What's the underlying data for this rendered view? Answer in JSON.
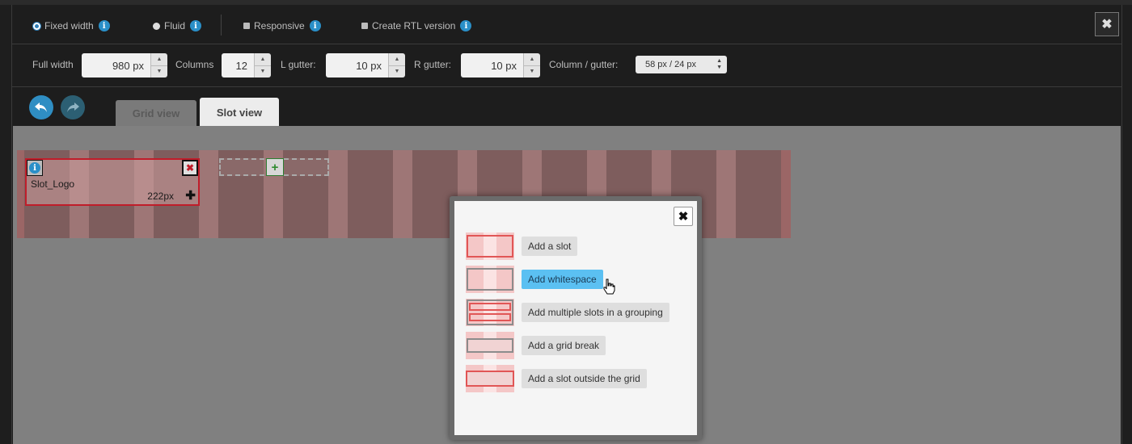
{
  "layout_modes": {
    "fixed_width": "Fixed width",
    "fluid": "Fluid",
    "responsive": "Responsive",
    "rtl": "Create RTL version",
    "info_glyph": "i"
  },
  "window": {
    "close_glyph": "✖"
  },
  "settings": {
    "full_width_label": "Full width",
    "full_width_value": "980 px",
    "columns_label": "Columns",
    "columns_value": "12",
    "l_gutter_label": "L gutter:",
    "l_gutter_value": "10 px",
    "r_gutter_label": "R gutter:",
    "r_gutter_value": "10 px",
    "col_gutter_label": "Column / gutter:",
    "col_gutter_value": "58 px / 24 px"
  },
  "tabs": {
    "grid": "Grid view",
    "slot": "Slot view"
  },
  "slot": {
    "name": "Slot_Logo",
    "size": "222px",
    "info_glyph": "i",
    "delete_glyph": "✖",
    "resize_glyph": "✚"
  },
  "add_slot": {
    "glyph": "+"
  },
  "popup": {
    "close_glyph": "✖",
    "options": [
      "Add a slot",
      "Add whitespace",
      "Add multiple slots in a grouping",
      "Add a grid break",
      "Add a slot outside the grid"
    ]
  },
  "colors": {
    "accent_blue": "#2a8fc8",
    "hover_blue": "#5bc0f2",
    "slot_red": "#c01d2a"
  }
}
